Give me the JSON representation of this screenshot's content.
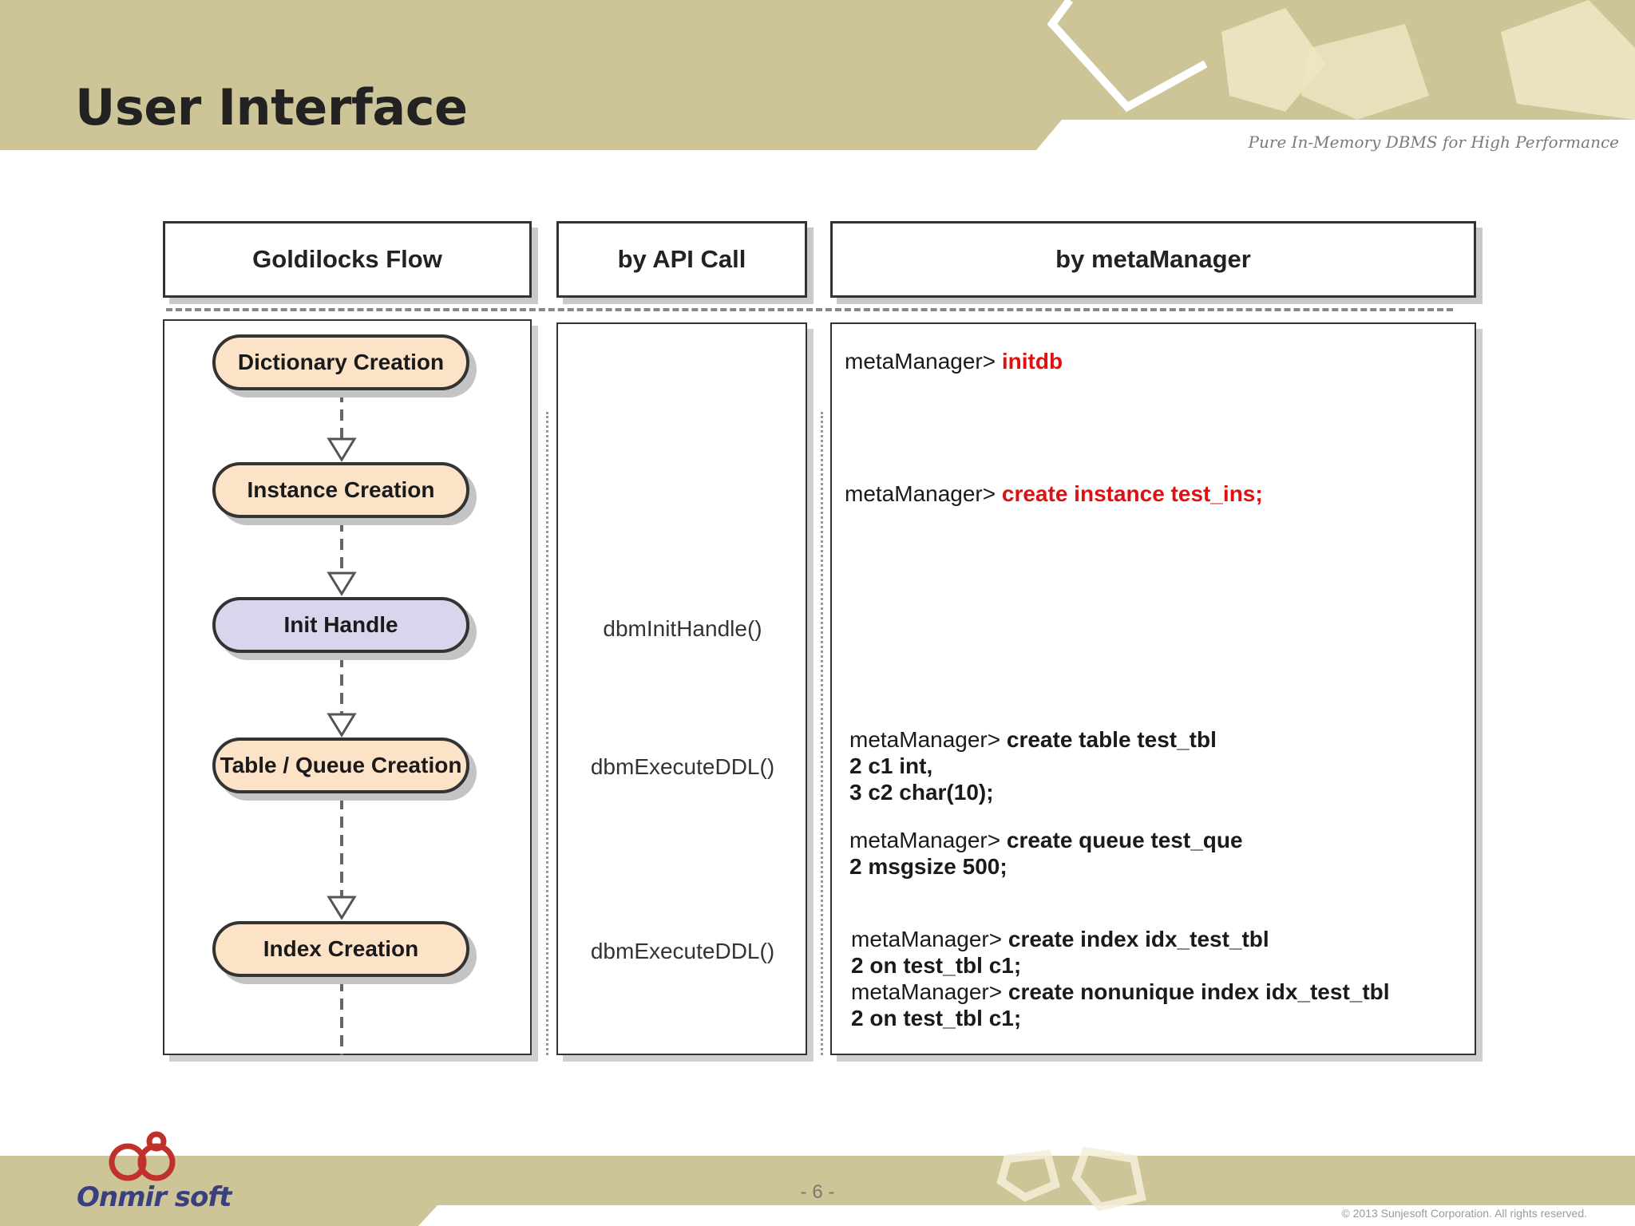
{
  "slide": {
    "title": "User Interface",
    "tagline": "Pure In-Memory DBMS for High Performance",
    "page_number": "- 6 -",
    "copyright": "© 2013 Sunjesoft Corporation. All rights reserved.",
    "logo_text": "Onmir soft"
  },
  "columns": {
    "flow": "Goldilocks Flow",
    "api": "by API Call",
    "meta": "by metaManager"
  },
  "flow_steps": [
    {
      "label": "Dictionary Creation",
      "color": "#fce3c8"
    },
    {
      "label": "Instance Creation",
      "color": "#fce3c8"
    },
    {
      "label": "Init Handle",
      "color": "#d7d6ec"
    },
    {
      "label": "Table / Queue Creation",
      "color": "#fce3c8"
    },
    {
      "label": "Index Creation",
      "color": "#fce3c8"
    }
  ],
  "api_calls": {
    "init_handle": "dbmInitHandle()",
    "execute_ddl_table": "dbmExecuteDDL()",
    "execute_ddl_index": "dbmExecuteDDL()"
  },
  "meta": {
    "prompt": "metaManager>",
    "initdb": "initdb",
    "create_instance": "create instance test_ins;",
    "create_table": "create table test_tbl",
    "table_line2": "2  c1 int,",
    "table_line3": "3  c2 char(10);",
    "create_queue": "create queue test_que",
    "queue_line2": "2  msgsize 500;",
    "create_index": "create index idx_test_tbl",
    "index_line2": "2  on test_tbl c1;",
    "create_nonunique": "create nonunique index idx_test_tbl",
    "nonunique_line2": "2  on test_tbl c1;"
  },
  "colors": {
    "banner": "#cdc597",
    "highlight": "#e01010",
    "logo": "#3a3f80"
  }
}
